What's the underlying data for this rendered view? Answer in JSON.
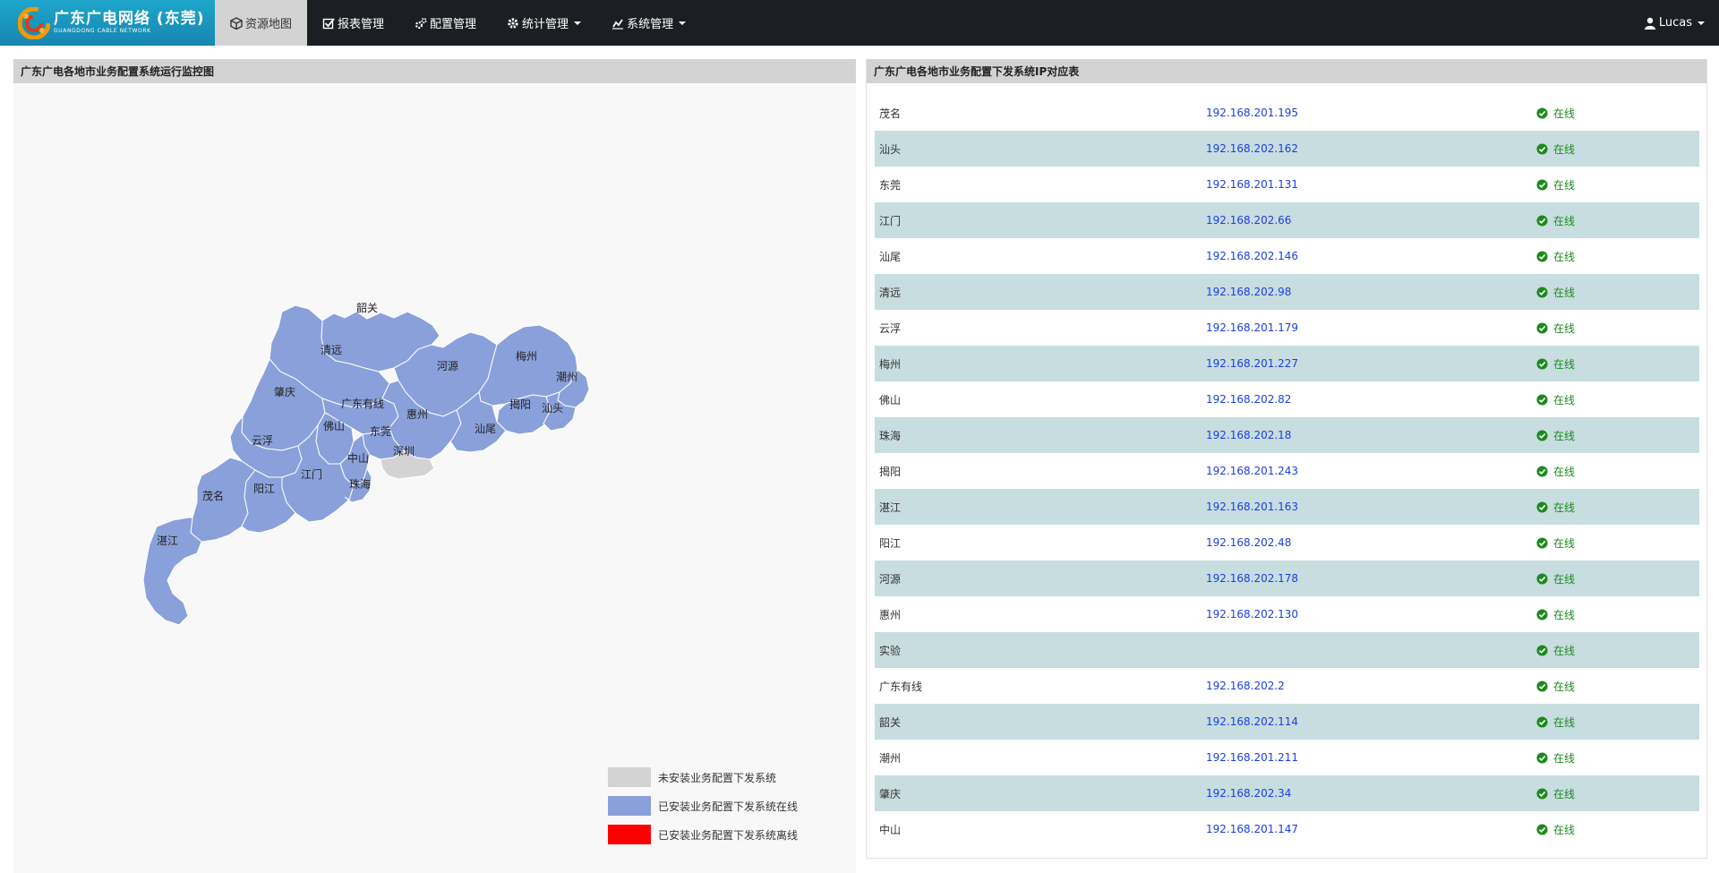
{
  "app": {
    "brand_title": "广东广电网络 (东莞)",
    "brand_sub": "GUANGDONG CABLE NETWORK",
    "logo_colors": [
      "#f39800",
      "#e8380d",
      "#f6b537"
    ]
  },
  "nav": {
    "items": [
      {
        "label": "资源地图",
        "icon": "cube-icon",
        "active": true
      },
      {
        "label": "报表管理",
        "icon": "checkbox-icon",
        "active": false
      },
      {
        "label": "配置管理",
        "icon": "cogs-icon",
        "active": false
      },
      {
        "label": "统计管理",
        "icon": "gear-icon",
        "active": false,
        "dropdown": true
      },
      {
        "label": "系统管理",
        "icon": "chart-icon",
        "active": false,
        "dropdown": true
      }
    ],
    "user": "Lucas"
  },
  "map_panel": {
    "title": "广东广电各地市业务配置系统运行监控图",
    "colors": {
      "not_installed": "#d3d3d3",
      "online": "#8aa0da",
      "offline": "#ff0000",
      "border": "#ffffff"
    },
    "regions": [
      {
        "name": "韶关",
        "status": "online"
      },
      {
        "name": "清远",
        "status": "online"
      },
      {
        "name": "河源",
        "status": "online"
      },
      {
        "name": "梅州",
        "status": "online"
      },
      {
        "name": "潮州",
        "status": "online"
      },
      {
        "name": "肇庆",
        "status": "online"
      },
      {
        "name": "广东有线",
        "status": "online"
      },
      {
        "name": "惠州",
        "status": "online"
      },
      {
        "name": "揭阳",
        "status": "online"
      },
      {
        "name": "汕头",
        "status": "online"
      },
      {
        "name": "佛山",
        "status": "online"
      },
      {
        "name": "东莞",
        "status": "online"
      },
      {
        "name": "汕尾",
        "status": "online"
      },
      {
        "name": "云浮",
        "status": "online"
      },
      {
        "name": "深圳",
        "status": "not_installed"
      },
      {
        "name": "中山",
        "status": "online"
      },
      {
        "name": "江门",
        "status": "online"
      },
      {
        "name": "茂名",
        "status": "online"
      },
      {
        "name": "阳江",
        "status": "online"
      },
      {
        "name": "珠海",
        "status": "online"
      },
      {
        "name": "湛江",
        "status": "online"
      }
    ],
    "legend": [
      {
        "label": "未安装业务配置下发系统",
        "color": "#d3d3d3"
      },
      {
        "label": "已安装业务配置下发系统在线",
        "color": "#8aa0da"
      },
      {
        "label": "已安装业务配置下发系统离线",
        "color": "#ff0000"
      }
    ]
  },
  "table_panel": {
    "title": "广东广电各地市业务配置下发系统IP对应表",
    "status_icon": "check-circle-icon",
    "rows": [
      {
        "city": "茂名",
        "ip": "192.168.201.195",
        "status": "在线"
      },
      {
        "city": "汕头",
        "ip": "192.168.202.162",
        "status": "在线"
      },
      {
        "city": "东莞",
        "ip": "192.168.201.131",
        "status": "在线"
      },
      {
        "city": "江门",
        "ip": "192.168.202.66",
        "status": "在线"
      },
      {
        "city": "汕尾",
        "ip": "192.168.202.146",
        "status": "在线"
      },
      {
        "city": "清远",
        "ip": "192.168.202.98",
        "status": "在线"
      },
      {
        "city": "云浮",
        "ip": "192.168.201.179",
        "status": "在线"
      },
      {
        "city": "梅州",
        "ip": "192.168.201.227",
        "status": "在线"
      },
      {
        "city": "佛山",
        "ip": "192.168.202.82",
        "status": "在线"
      },
      {
        "city": "珠海",
        "ip": "192.168.202.18",
        "status": "在线"
      },
      {
        "city": "揭阳",
        "ip": "192.168.201.243",
        "status": "在线"
      },
      {
        "city": "湛江",
        "ip": "192.168.201.163",
        "status": "在线"
      },
      {
        "city": "阳江",
        "ip": "192.168.202.48",
        "status": "在线"
      },
      {
        "city": "河源",
        "ip": "192.168.202.178",
        "status": "在线"
      },
      {
        "city": "惠州",
        "ip": "192.168.202.130",
        "status": "在线"
      },
      {
        "city": "实验",
        "ip": "",
        "status": "在线"
      },
      {
        "city": "广东有线",
        "ip": "192.168.202.2",
        "status": "在线"
      },
      {
        "city": "韶关",
        "ip": "192.168.202.114",
        "status": "在线"
      },
      {
        "city": "潮州",
        "ip": "192.168.201.211",
        "status": "在线"
      },
      {
        "city": "肇庆",
        "ip": "192.168.202.34",
        "status": "在线"
      },
      {
        "city": "中山",
        "ip": "192.168.201.147",
        "status": "在线"
      }
    ]
  }
}
